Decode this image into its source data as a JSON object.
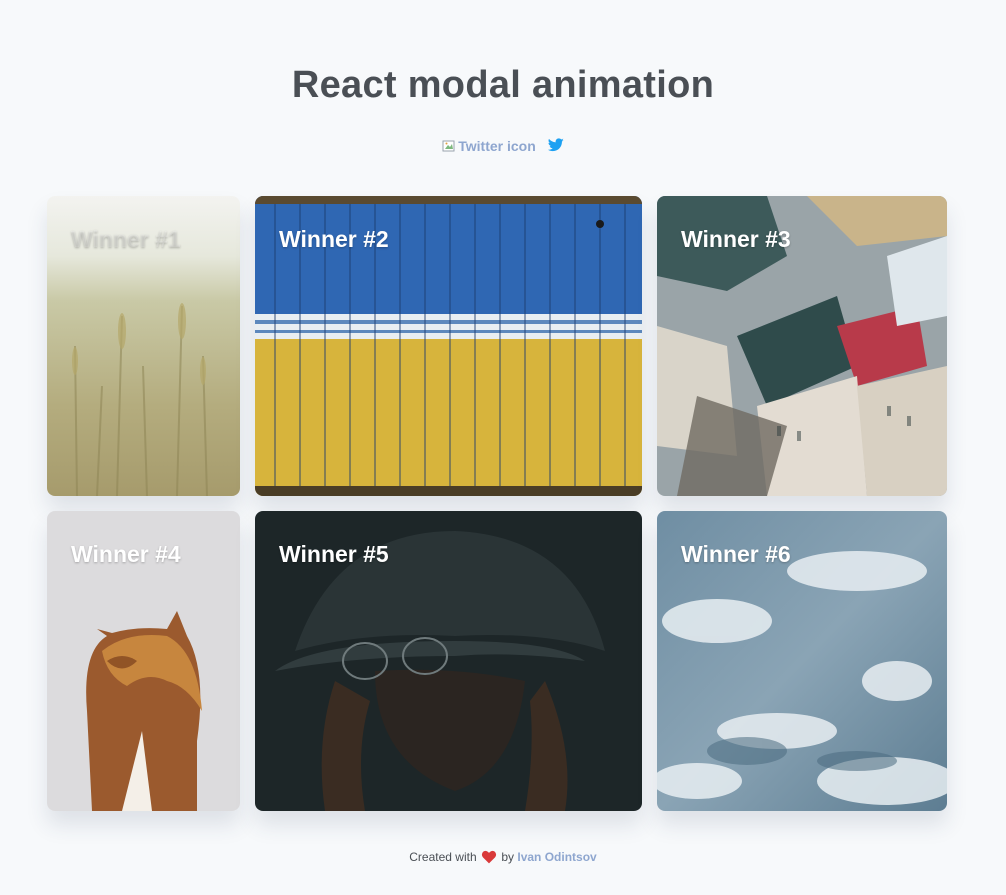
{
  "header": {
    "title": "React modal animation",
    "twitter_alt": "Twitter icon"
  },
  "cards": [
    {
      "label": "Winner #1",
      "image": "wheat-field"
    },
    {
      "label": "Winner #2",
      "image": "blue-yellow-wooden-fence"
    },
    {
      "label": "Winner #3",
      "image": "city-rooftops-aerial"
    },
    {
      "label": "Winner #4",
      "image": "horse-with-mane"
    },
    {
      "label": "Winner #5",
      "image": "person-in-cap-with-glasses"
    },
    {
      "label": "Winner #6",
      "image": "cloudy-sky"
    }
  ],
  "footer": {
    "prefix": "Created with",
    "middle": "by",
    "author": "Ivan Odintsov"
  },
  "colors": {
    "background": "#f7f9fb",
    "title": "#4a4f55",
    "link": "#8ea6cf",
    "twitter": "#1da1f2",
    "heart": "#d93a3a"
  }
}
